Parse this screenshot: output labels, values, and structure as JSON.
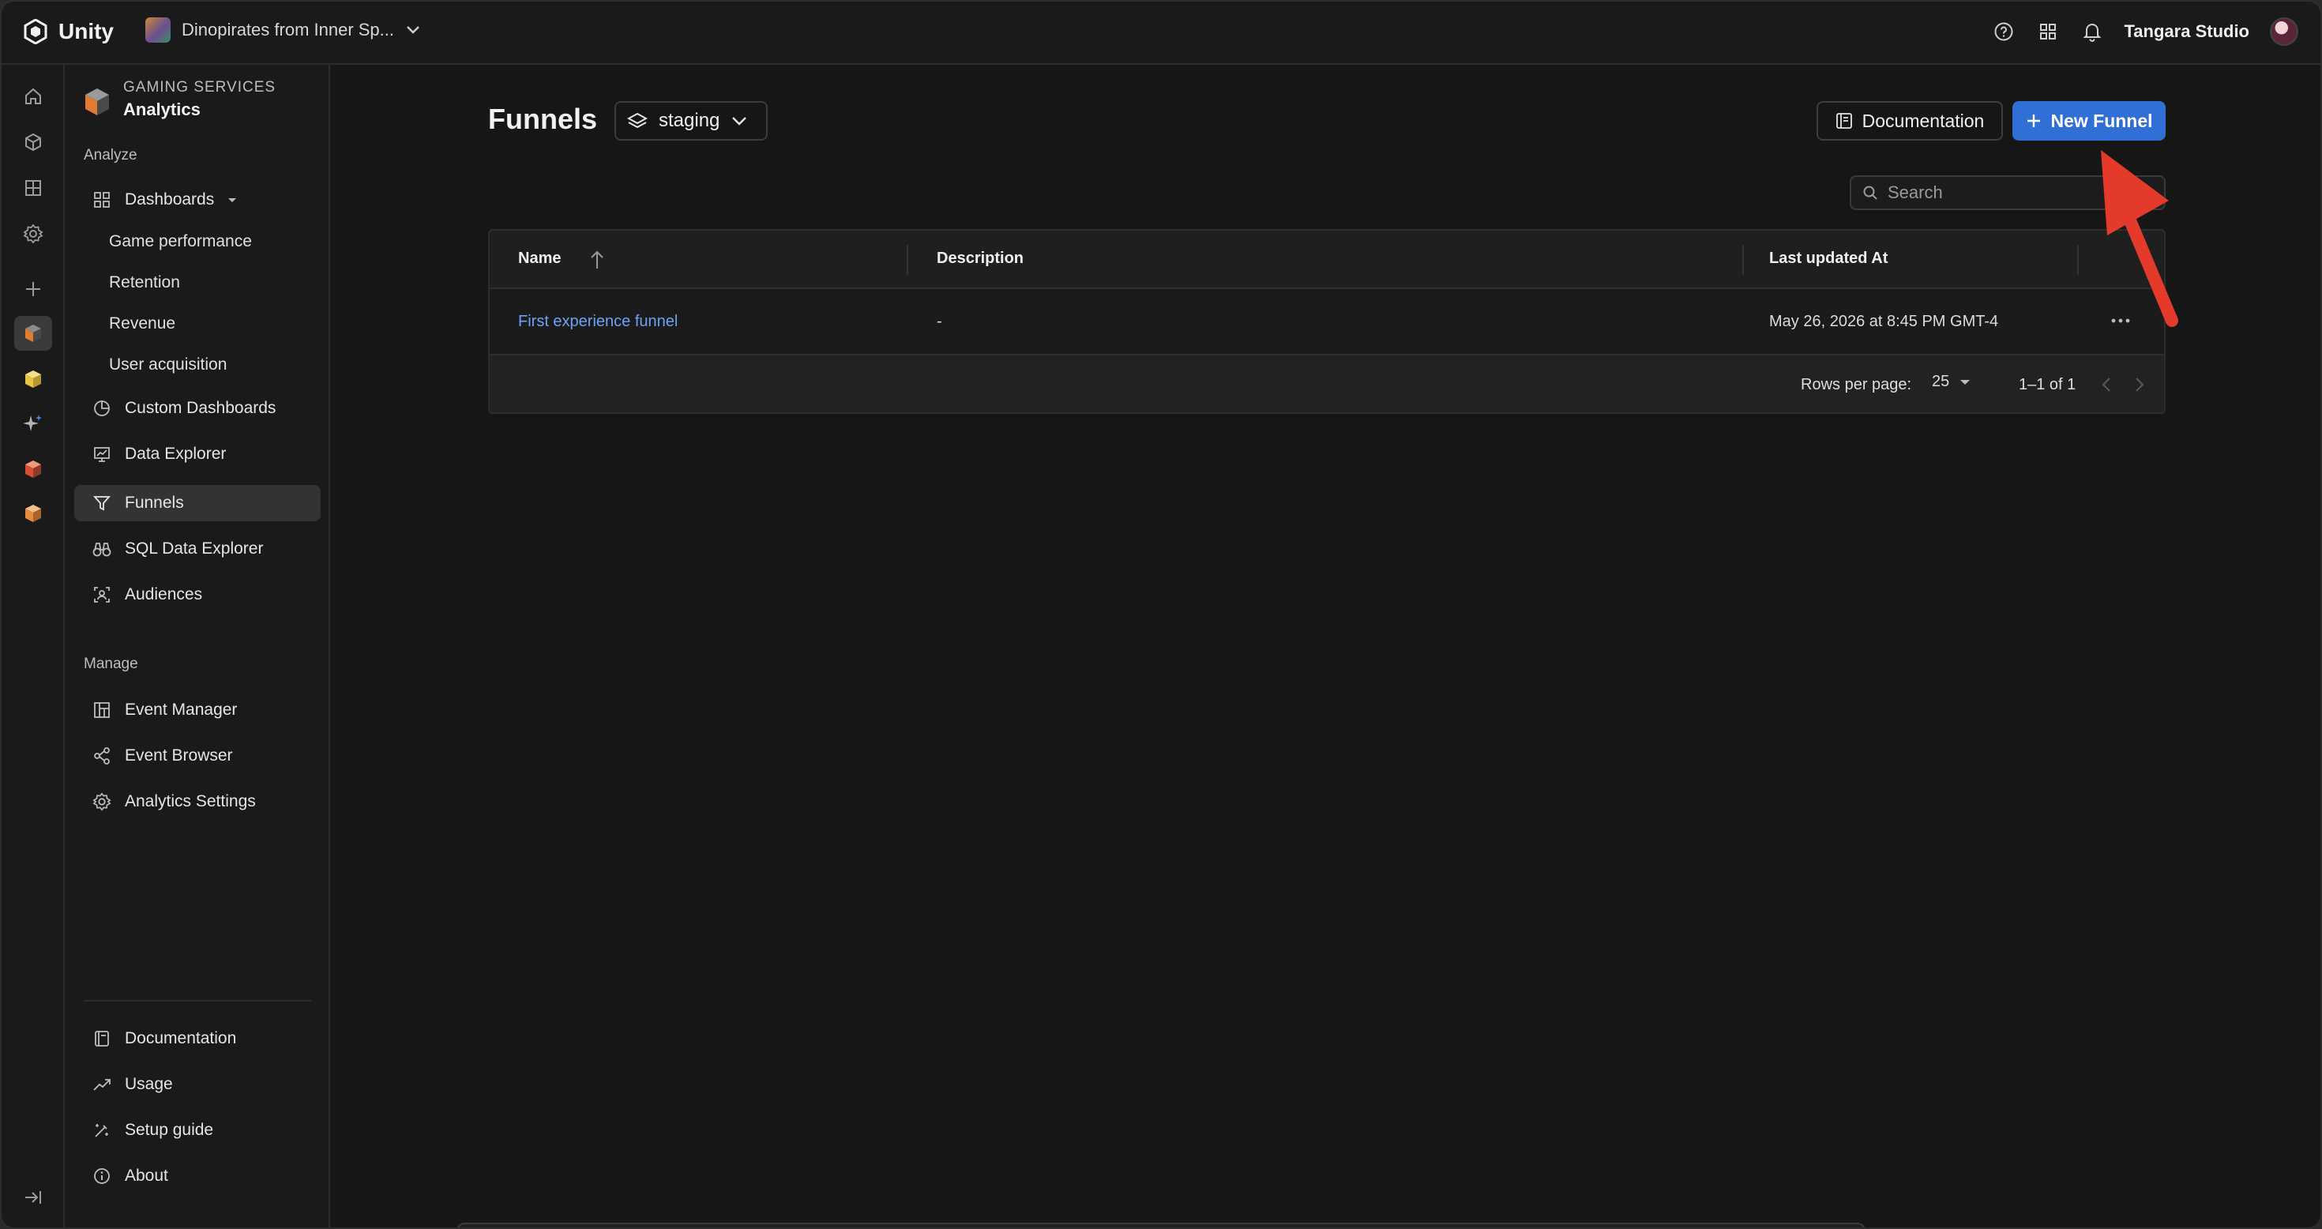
{
  "app": {
    "name": "Unity",
    "project": "Dinopirates from Inner Sp...",
    "studio": "Tangara Studio"
  },
  "service": {
    "overline": "GAMING SERVICES",
    "title": "Analytics"
  },
  "sidebar": {
    "analyze_label": "Analyze",
    "dashboards": "Dashboards",
    "dashboard_subs": [
      "Game performance",
      "Retention",
      "Revenue",
      "User acquisition"
    ],
    "custom_dashboards": "Custom Dashboards",
    "data_explorer": "Data Explorer",
    "funnels": "Funnels",
    "sql_data_explorer": "SQL Data Explorer",
    "audiences": "Audiences",
    "manage_label": "Manage",
    "event_manager": "Event Manager",
    "event_browser": "Event Browser",
    "analytics_settings": "Analytics Settings",
    "documentation": "Documentation",
    "usage": "Usage",
    "setup_guide": "Setup guide",
    "about": "About"
  },
  "page": {
    "title": "Funnels",
    "environment": "staging",
    "documentation_button": "Documentation",
    "new_button": "New Funnel",
    "search_placeholder": "Search"
  },
  "table": {
    "columns": [
      "Name",
      "Description",
      "Last updated At"
    ],
    "rows": [
      {
        "name": "First experience funnel",
        "description": "-",
        "updated": "May 26, 2026 at 8:45 PM GMT-4"
      }
    ],
    "rows_per_page_label": "Rows per page:",
    "rows_per_page": "25",
    "range": "1–1 of 1"
  },
  "colors": {
    "accent": "#2f6fd6",
    "link": "#6aa3f5",
    "annotation_arrow": "#e43a2c"
  }
}
